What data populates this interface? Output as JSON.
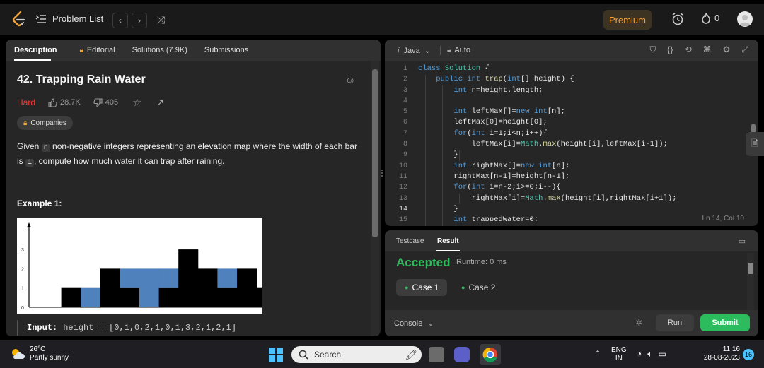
{
  "topbar": {
    "problem_list": "Problem List",
    "premium": "Premium",
    "streak": "0"
  },
  "tabs": [
    {
      "label": "Description"
    },
    {
      "label": "Editorial"
    },
    {
      "label": "Solutions (7.9K)"
    },
    {
      "label": "Submissions"
    }
  ],
  "problem": {
    "title": "42. Trapping Rain Water",
    "difficulty": "Hard",
    "likes": "28.7K",
    "dislikes": "405",
    "companies": "Companies",
    "desc_1": "Given ",
    "desc_code_n": "n",
    "desc_2": " non-negative integers representing an elevation map where the width of each bar is ",
    "desc_code_1": "1",
    "desc_3": ", compute how much water it can trap after raining.",
    "example_heading": "Example 1:",
    "input_label": "Input:",
    "input_value": "height = [0,1,0,2,1,0,1,3,2,1,2,1]"
  },
  "figure": {
    "heights": [
      0,
      1,
      0,
      2,
      1,
      0,
      1,
      3,
      2,
      1,
      2,
      1
    ],
    "water": [
      0,
      0,
      1,
      0,
      1,
      2,
      1,
      0,
      0,
      1,
      0,
      0
    ],
    "y_ticks": [
      "0",
      "1",
      "2",
      "3"
    ],
    "bar_color": "#000000",
    "water_color": "#4f81bd"
  },
  "editor": {
    "language": "Java",
    "mode": "Auto",
    "cursor": "Ln 14, Col 10",
    "current_line": 14,
    "line_numbers": [
      "1",
      "2",
      "3",
      "4",
      "5",
      "6",
      "7",
      "8",
      "9",
      "10",
      "11",
      "12",
      "13",
      "14",
      "15"
    ]
  },
  "result": {
    "tab_testcase": "Testcase",
    "tab_result": "Result",
    "status": "Accepted",
    "runtime": "Runtime: 0 ms",
    "case1": "Case 1",
    "case2": "Case 2",
    "console": "Console",
    "run": "Run",
    "submit": "Submit"
  },
  "taskbar": {
    "temp": "26°C",
    "weather": "Partly sunny",
    "search": "Search",
    "lang1": "ENG",
    "lang2": "IN",
    "time": "11:16",
    "date": "28-08-2023",
    "notifications": "16"
  },
  "colors": {
    "accent_green": "#2cbb5d",
    "hard_red": "#f63636",
    "premium_orange": "#f0a23b"
  }
}
